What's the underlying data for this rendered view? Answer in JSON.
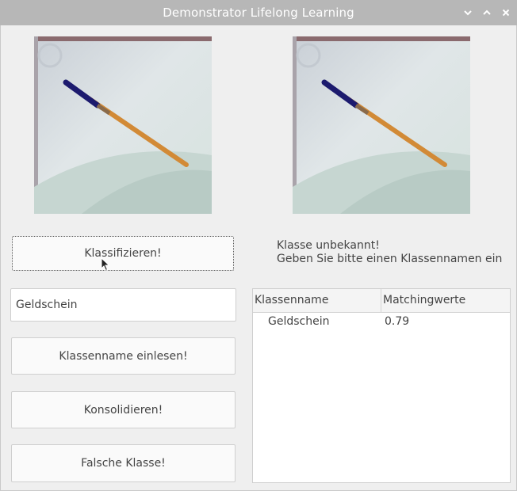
{
  "window": {
    "title": "Demonstrator Lifelong Learning",
    "controls": [
      "minimize",
      "maximize",
      "close"
    ]
  },
  "buttons": {
    "classify": "Klassifizieren!",
    "read_class_name": "Klassenname einlesen!",
    "consolidate": "Konsolidieren!",
    "wrong_class": "Falsche Klasse!"
  },
  "input": {
    "class_name_value": "Geldschein"
  },
  "message": {
    "line1": "Klasse unbekannt!",
    "line2": "Geben Sie bitte einen Klassennamen ein"
  },
  "table": {
    "headers": [
      "Klassenname",
      "Matchingwerte"
    ],
    "rows": [
      {
        "name": "Geldschein",
        "value": "0.79"
      }
    ]
  },
  "colors": {
    "titlebar": "#b7b7b7",
    "window_bg": "#efefef",
    "pen_body": "#d8892e",
    "pen_cap": "#1c1a6e"
  }
}
